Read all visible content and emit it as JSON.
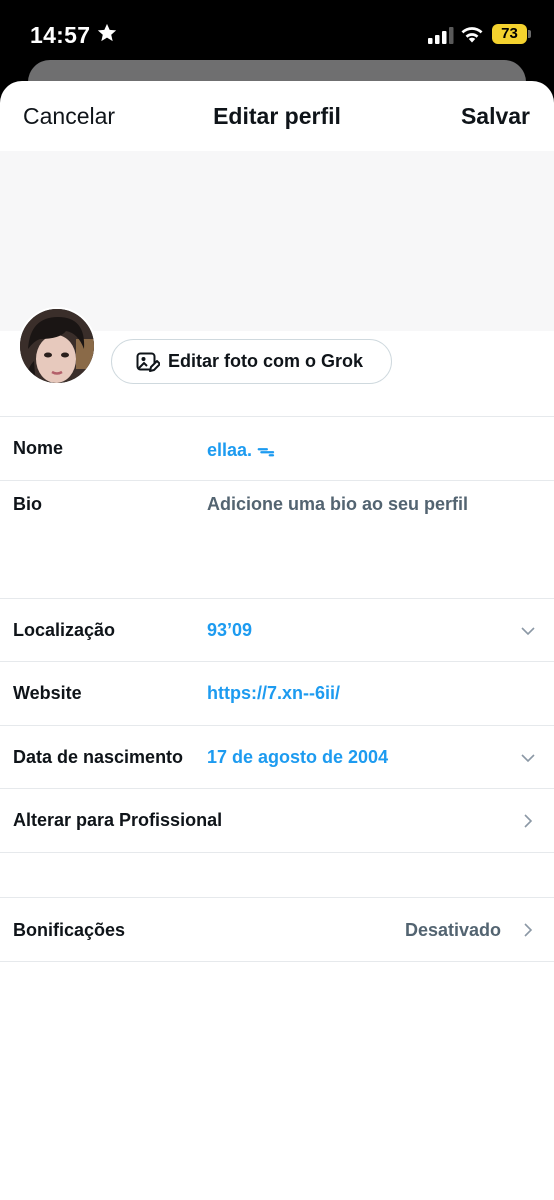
{
  "status": {
    "time": "14:57",
    "battery": "73"
  },
  "nav": {
    "cancel": "Cancelar",
    "title": "Editar perfil",
    "save": "Salvar"
  },
  "grok_button": "Editar foto com o Grok",
  "fields": {
    "name": {
      "label": "Nome",
      "value": "ellaa. ᯓ"
    },
    "bio": {
      "label": "Bio",
      "placeholder": "Adicione uma bio ao seu perfil"
    },
    "location": {
      "label": "Localização",
      "value": "93’09"
    },
    "website": {
      "label": "Website",
      "value": "https://7.xn--6ii/"
    },
    "birthdate": {
      "label": "Data de nascimento",
      "value": "17 de agosto de 2004"
    },
    "professional": {
      "label": "Alterar para Profissional"
    },
    "tips": {
      "label": "Bonificações",
      "value": "Desativado"
    }
  },
  "colors": {
    "accent": "#1d9bf0",
    "muted": "#536471",
    "battery": "#f4d22e"
  }
}
